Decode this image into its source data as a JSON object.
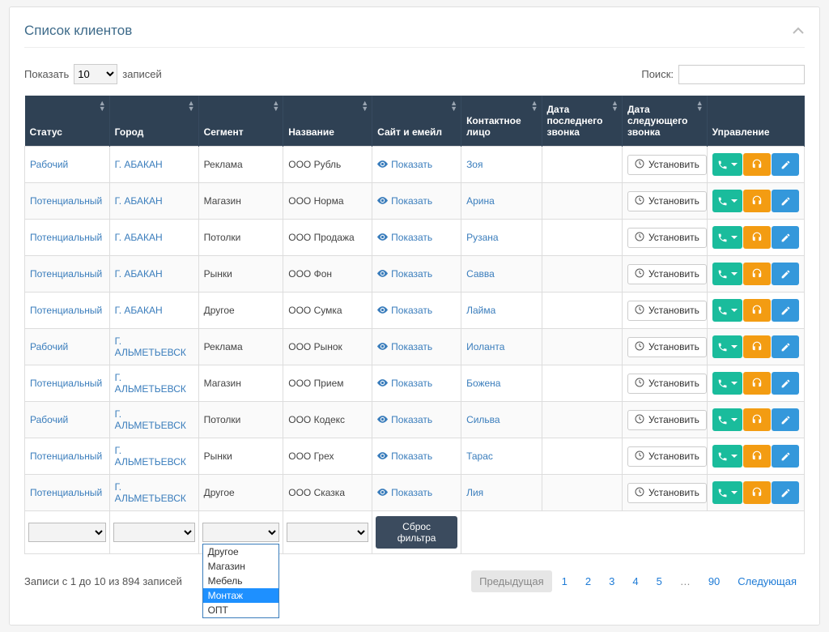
{
  "panel": {
    "title": "Список клиентов"
  },
  "toolbar": {
    "show": "Показать",
    "entries": "записей",
    "page_size": "10",
    "search_label": "Поиск:"
  },
  "headers": {
    "c0": "Статус",
    "c1": "Город",
    "c2": "Сегмент",
    "c3": "Название",
    "c4": "Сайт и емейл",
    "c5": "Контактное лицо",
    "c6": "Дата последнего звонка",
    "c7": "Дата следующего звонка",
    "c8": "Управление"
  },
  "col_buttons": {
    "show": "Показать",
    "set": "Установить",
    "reset": "Сброс фильтра"
  },
  "rows": [
    {
      "status": "Рабочий",
      "city": "Г. АБАКАН",
      "segment": "Реклама",
      "name": "ООО Рубль",
      "contact": "Зоя"
    },
    {
      "status": "Потенциальный",
      "city": "Г. АБАКАН",
      "segment": "Магазин",
      "name": "ООО Норма",
      "contact": "Арина"
    },
    {
      "status": "Потенциальный",
      "city": "Г. АБАКАН",
      "segment": "Потолки",
      "name": "ООО Продажа",
      "contact": "Рузана"
    },
    {
      "status": "Потенциальный",
      "city": "Г. АБАКАН",
      "segment": "Рынки",
      "name": "ООО Фон",
      "contact": "Савва"
    },
    {
      "status": "Потенциальный",
      "city": "Г. АБАКАН",
      "segment": "Другое",
      "name": "ООО Сумка",
      "contact": "Лайма"
    },
    {
      "status": "Рабочий",
      "city": "Г. АЛЬМЕТЬЕВСК",
      "segment": "Реклама",
      "name": "ООО Рынок",
      "contact": "Иоланта"
    },
    {
      "status": "Потенциальный",
      "city": "Г. АЛЬМЕТЬЕВСК",
      "segment": "Магазин",
      "name": "ООО Прием",
      "contact": "Божена"
    },
    {
      "status": "Рабочий",
      "city": "Г. АЛЬМЕТЬЕВСК",
      "segment": "Потолки",
      "name": "ООО Кодекс",
      "contact": "Сильва"
    },
    {
      "status": "Потенциальный",
      "city": "Г. АЛЬМЕТЬЕВСК",
      "segment": "Рынки",
      "name": "ООО Грех",
      "contact": "Тарас"
    },
    {
      "status": "Потенциальный",
      "city": "Г. АЛЬМЕТЬЕВСК",
      "segment": "Другое",
      "name": "ООО Сказка",
      "contact": "Лия"
    }
  ],
  "dropdown": {
    "options": [
      "Другое",
      "Магазин",
      "Мебель",
      "Монтаж",
      "ОПТ"
    ],
    "highlighted": "Монтаж"
  },
  "info": "Записи с 1 до 10 из 894 записей",
  "pager": {
    "prev": "Предыдущая",
    "next": "Следующая",
    "pages": [
      "1",
      "2",
      "3",
      "4",
      "5",
      "…",
      "90"
    ],
    "active": "1"
  }
}
